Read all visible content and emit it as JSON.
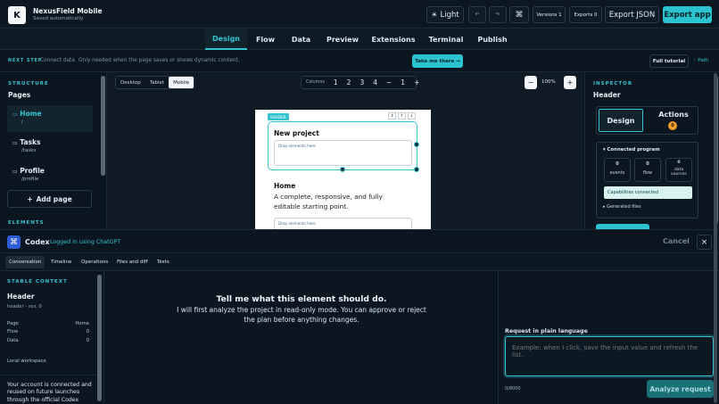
{
  "app": {
    "logo": "K",
    "title": "NexusField Mobile",
    "subtitle": "Saved automatically"
  },
  "toolbar": {
    "theme_label": "Light",
    "versions": "Versions 1",
    "exports": "Exports 0",
    "export_json": "Export JSON",
    "export_app": "Export app"
  },
  "tabs": [
    "Design",
    "Flow",
    "Data",
    "Preview",
    "Extensions",
    "Terminal",
    "Publish"
  ],
  "next_step": {
    "label": "NEXT STEP",
    "title": "Connect data",
    "text": "Only needed when the page saves or shows dynamic content.",
    "button": "Take me there →",
    "tutorial": "Full tutorial",
    "path": "Path"
  },
  "structure": {
    "title": "STRUCTURE",
    "pages_label": "Pages",
    "pages": [
      {
        "name": "Home",
        "path": "/"
      },
      {
        "name": "Tasks",
        "path": "/tasks"
      },
      {
        "name": "Profile",
        "path": "/profile"
      }
    ],
    "add_page": "Add page",
    "elements_title": "ELEMENTS"
  },
  "canvas": {
    "devices": [
      "Desktop",
      "Tablet",
      "Mobile"
    ],
    "columns_label": "Columns",
    "columns": [
      "1",
      "2",
      "3",
      "4"
    ],
    "col_minus": "−",
    "col_value": "1",
    "col_plus": "+",
    "zoom_minus": "−",
    "zoom": "100%",
    "zoom_plus": "+",
    "header_tag": "HEADER",
    "header_controls": [
      "⇕",
      "↑",
      "↓"
    ],
    "header_title": "New project",
    "drop_hint": "Drop elements here",
    "home_title": "Home",
    "home_text": "A complete, responsive, and fully editable starting point.",
    "drop_hint2": "Drop elements here"
  },
  "inspector": {
    "title": "INSPECTOR",
    "element": "Header",
    "design_tab": "Design",
    "actions_tab": "Actions",
    "actions_count": "0",
    "connected_title": "Connected program",
    "stats": [
      {
        "value": "0",
        "label": "events"
      },
      {
        "value": "0",
        "label": "flow"
      },
      {
        "value": "0",
        "label": "data sources"
      }
    ],
    "capabilities": "Capabilities connected",
    "generated": "Generated files"
  },
  "codex": {
    "title": "Codex",
    "status": "Logged in using ChatGPT",
    "cancel": "Cancel",
    "close": "×",
    "tabs": [
      "Conversation",
      "Timeline",
      "Operations",
      "Files and diff",
      "Tests"
    ]
  },
  "context": {
    "title": "STABLE CONTEXT",
    "element": "Header",
    "revision": "header - rev. 0",
    "rows": [
      {
        "key": "Page",
        "value": "Home"
      },
      {
        "key": "Flow",
        "value": "0"
      },
      {
        "key": "Data",
        "value": "0"
      }
    ],
    "workspace": "Local workspace",
    "account_note": "Your account is connected and reused on future launches through the official Codex"
  },
  "conversation": {
    "heading": "Tell me what this element should do.",
    "body": "I will first analyze the project in read-only mode. You can approve or reject the plan before anything changes."
  },
  "request": {
    "label": "Request in plain language",
    "placeholder": "Example: when I click, save the input value and refresh the list.",
    "counter": "0/8000",
    "analyze": "Analyze request"
  }
}
